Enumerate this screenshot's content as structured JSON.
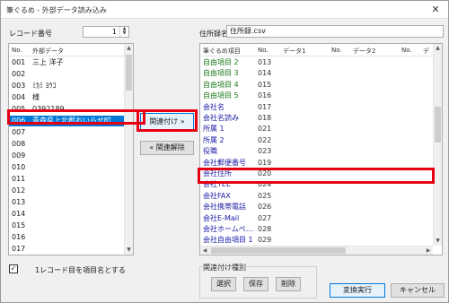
{
  "window": {
    "title": "筆ぐるめ - 外部データ読み込み",
    "close_glyph": "✕"
  },
  "left": {
    "record_label": "レコード番号",
    "record_value": "1",
    "headers": {
      "no": "No.",
      "data": "外部データ"
    },
    "rows": [
      {
        "no": "001",
        "data": "三上 洋子"
      },
      {
        "no": "002",
        "data": ""
      },
      {
        "no": "003",
        "data": "ﾐｶﾐ ﾖｳｺ"
      },
      {
        "no": "004",
        "data": "様"
      },
      {
        "no": "005",
        "data": "0392189"
      },
      {
        "no": "006",
        "data": "青森県上北郡おいらせ町…"
      },
      {
        "no": "007",
        "data": ""
      },
      {
        "no": "008",
        "data": ""
      },
      {
        "no": "009",
        "data": ""
      },
      {
        "no": "010",
        "data": ""
      },
      {
        "no": "011",
        "data": ""
      },
      {
        "no": "012",
        "data": ""
      },
      {
        "no": "013",
        "data": ""
      },
      {
        "no": "014",
        "data": ""
      },
      {
        "no": "015",
        "data": ""
      },
      {
        "no": "016",
        "data": ""
      },
      {
        "no": "017",
        "data": ""
      }
    ],
    "selected_index": 5
  },
  "middle": {
    "link_button": "関連付け »",
    "unlink_button": "« 関連解除"
  },
  "right": {
    "addressbook_label": "住所録名",
    "addressbook_value": "住所録.csv",
    "headers": {
      "item": "筆ぐるめ項目",
      "no1": "No.",
      "data1": "データ1",
      "no2": "No.",
      "data2": "データ2",
      "no3": "No.",
      "data3": "デ"
    },
    "rows": [
      {
        "item": "自由項目 2",
        "no": "013",
        "color": "green"
      },
      {
        "item": "自由項目 3",
        "no": "014",
        "color": "green"
      },
      {
        "item": "自由項目 4",
        "no": "015",
        "color": "green"
      },
      {
        "item": "自由項目 5",
        "no": "016",
        "color": "green"
      },
      {
        "item": "会社名",
        "no": "017",
        "color": "blue"
      },
      {
        "item": "会社名読み",
        "no": "018",
        "color": "blue"
      },
      {
        "item": "所属 1",
        "no": "021",
        "color": "blue"
      },
      {
        "item": "所属 2",
        "no": "022",
        "color": "blue"
      },
      {
        "item": "役職",
        "no": "023",
        "color": "blue"
      },
      {
        "item": "会社郵便番号",
        "no": "019",
        "color": "blue"
      },
      {
        "item": "会社住所",
        "no": "020",
        "color": "blue"
      },
      {
        "item": "会社TEL",
        "no": "024",
        "color": "blue"
      },
      {
        "item": "会社FAX",
        "no": "025",
        "color": "blue"
      },
      {
        "item": "会社携帯電話",
        "no": "026",
        "color": "blue"
      },
      {
        "item": "会社E-Mail",
        "no": "027",
        "color": "blue"
      },
      {
        "item": "会社ホームペ…",
        "no": "028",
        "color": "blue"
      },
      {
        "item": "会社自由項目 1",
        "no": "029",
        "color": "blue"
      }
    ],
    "highlight_index": 10
  },
  "footer": {
    "checkbox_label": "1レコード目を項目名とする",
    "checkbox_checked": "✓",
    "group_label": "関連付け種別",
    "select_button": "選択",
    "save_button": "保存",
    "delete_button": "削除",
    "execute_button": "変換実行",
    "cancel_button": "キャンセル"
  },
  "colors": {
    "highlight": "#e60012",
    "selection": "#0078d7"
  }
}
